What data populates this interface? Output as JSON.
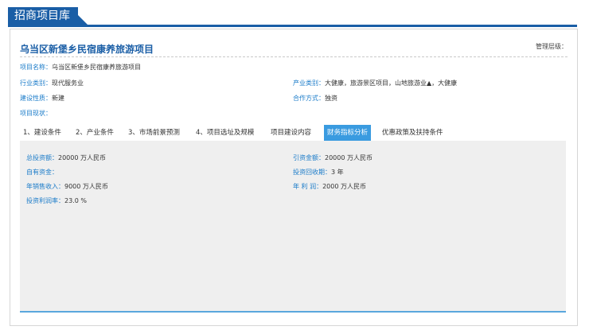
{
  "header": {
    "title": "招商项目库"
  },
  "project": {
    "title": "乌当区新堡乡民宿康养旅游项目",
    "level_label": "管理层级："
  },
  "info": {
    "name_label": "项目名称：",
    "name_value": "乌当区新堡乡民宿康养旅游项目",
    "industry_label": "行业类别：",
    "industry_value": "现代服务业",
    "product_label": "产业类别：",
    "product_value": "大健康，旅游景区项目，山地旅游业▲，大健康",
    "build_label": "建设性质：",
    "build_value": "新建",
    "coop_label": "合作方式：",
    "coop_value": "独资",
    "status_label": "项目现状："
  },
  "tabs": [
    {
      "label": "1、建设条件"
    },
    {
      "label": "2、产业条件"
    },
    {
      "label": "3、市场前景预测"
    },
    {
      "label": "4、项目选址及规模"
    },
    {
      "label": "项目建设内容"
    },
    {
      "label": "财务指标分析"
    },
    {
      "label": "优惠政策及扶持条件"
    }
  ],
  "finance": {
    "total_label": "总投资额：",
    "total_value": "20000 万人民币",
    "attract_label": "引资金额：",
    "attract_value": "20000 万人民币",
    "self_label": "自有资金：",
    "self_value": "",
    "payback_label": "投资回收期：",
    "payback_value": "3 年",
    "sales_label": "年销售收入：",
    "sales_value": "9000 万人民币",
    "profit_label": "年 利 润：",
    "profit_value": "2000 万人民币",
    "margin_label": "投资利润率：",
    "margin_value": "23.0 %"
  },
  "colors": {
    "brand": "#1a5ea6",
    "accent": "#3a9be0",
    "label": "#1a7bc9"
  }
}
